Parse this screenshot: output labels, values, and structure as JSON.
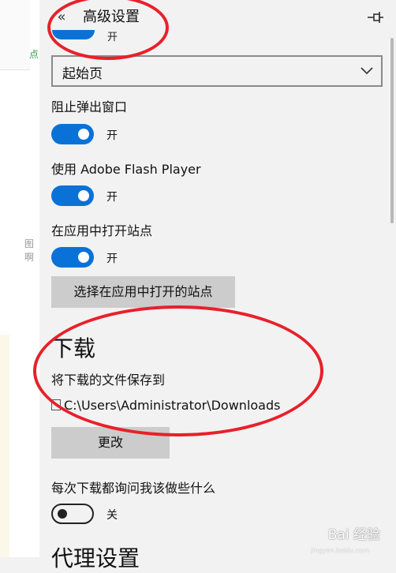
{
  "background_page": {
    "green_text": "点",
    "gray_text": "图啊"
  },
  "header": {
    "title": "高级设置",
    "back_icon": "back-chevron-icon",
    "pin_icon": "pin-icon"
  },
  "top_toggle": {
    "state_label": "开"
  },
  "home_select": {
    "value": "起始页"
  },
  "popup_block": {
    "label": "阻止弹出窗口",
    "state_label": "开"
  },
  "flash": {
    "label": "使用 Adobe Flash Player",
    "state_label": "开"
  },
  "open_in_app": {
    "label": "在应用中打开站点",
    "state_label": "开",
    "button_label": "选择在应用中打开的站点"
  },
  "downloads": {
    "heading": "下载",
    "save_to_label": "将下载的文件保存到",
    "path": "C:\\Users\\Administrator\\Downloads",
    "change_button": "更改",
    "ask_label": "每次下载都询问我该做些什么",
    "ask_state_label": "关"
  },
  "proxy": {
    "heading": "代理设置"
  },
  "watermark": {
    "text": "Bai 经验",
    "sub": "jingyan.baidu.com"
  },
  "colors": {
    "accent": "#0a72d6",
    "annotation": "#e8202a",
    "button_bg": "#cccccc",
    "panel_bg": "#f2f2f2"
  }
}
